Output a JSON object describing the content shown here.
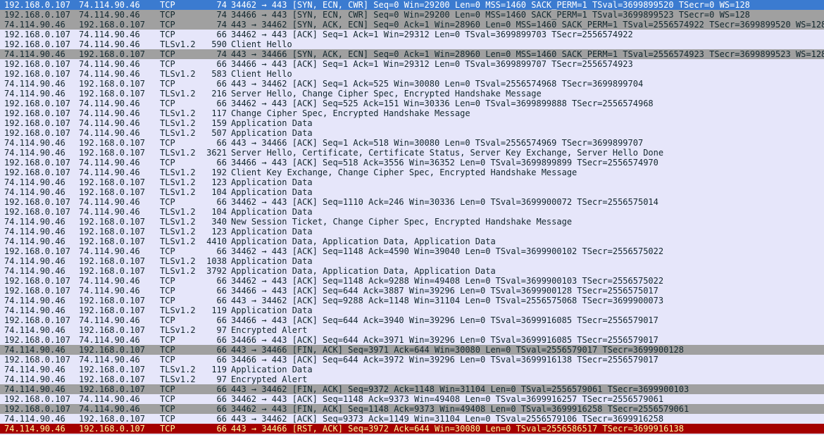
{
  "packets": [
    {
      "src": "192.168.0.107",
      "dst": "74.114.90.46",
      "proto": "TCP",
      "len": "74",
      "info": "34462 → 443 [SYN, ECN, CWR] Seq=0 Win=29200 Len=0 MSS=1460 SACK_PERM=1 TSval=3699899520 TSecr=0 WS=128",
      "style": "sel"
    },
    {
      "src": "192.168.0.107",
      "dst": "74.114.90.46",
      "proto": "TCP",
      "len": "74",
      "info": "34466 → 443 [SYN, ECN, CWR] Seq=0 Win=29200 Len=0 MSS=1460 SACK_PERM=1 TSval=3699899523 TSecr=0 WS=128",
      "style": "flag"
    },
    {
      "src": "74.114.90.46",
      "dst": "192.168.0.107",
      "proto": "TCP",
      "len": "74",
      "info": "443 → 34462 [SYN, ACK, ECN] Seq=0 Ack=1 Win=28960 Len=0 MSS=1460 SACK_PERM=1 TSval=2556574922 TSecr=3699899520 WS=128",
      "style": "flag"
    },
    {
      "src": "192.168.0.107",
      "dst": "74.114.90.46",
      "proto": "TCP",
      "len": "66",
      "info": "34462 → 443 [ACK] Seq=1 Ack=1 Win=29312 Len=0 TSval=3699899703 TSecr=2556574922",
      "style": ""
    },
    {
      "src": "192.168.0.107",
      "dst": "74.114.90.46",
      "proto": "TLSv1.2",
      "len": "590",
      "info": "Client Hello",
      "style": ""
    },
    {
      "src": "74.114.90.46",
      "dst": "192.168.0.107",
      "proto": "TCP",
      "len": "74",
      "info": "443 → 34466 [SYN, ACK, ECN] Seq=0 Ack=1 Win=28960 Len=0 MSS=1460 SACK_PERM=1 TSval=2556574923 TSecr=3699899523 WS=128",
      "style": "flag"
    },
    {
      "src": "192.168.0.107",
      "dst": "74.114.90.46",
      "proto": "TCP",
      "len": "66",
      "info": "34466 → 443 [ACK] Seq=1 Ack=1 Win=29312 Len=0 TSval=3699899707 TSecr=2556574923",
      "style": ""
    },
    {
      "src": "192.168.0.107",
      "dst": "74.114.90.46",
      "proto": "TLSv1.2",
      "len": "583",
      "info": "Client Hello",
      "style": ""
    },
    {
      "src": "74.114.90.46",
      "dst": "192.168.0.107",
      "proto": "TCP",
      "len": "66",
      "info": "443 → 34462 [ACK] Seq=1 Ack=525 Win=30080 Len=0 TSval=2556574968 TSecr=3699899704",
      "style": ""
    },
    {
      "src": "74.114.90.46",
      "dst": "192.168.0.107",
      "proto": "TLSv1.2",
      "len": "216",
      "info": "Server Hello, Change Cipher Spec, Encrypted Handshake Message",
      "style": ""
    },
    {
      "src": "192.168.0.107",
      "dst": "74.114.90.46",
      "proto": "TCP",
      "len": "66",
      "info": "34462 → 443 [ACK] Seq=525 Ack=151 Win=30336 Len=0 TSval=3699899888 TSecr=2556574968",
      "style": ""
    },
    {
      "src": "192.168.0.107",
      "dst": "74.114.90.46",
      "proto": "TLSv1.2",
      "len": "117",
      "info": "Change Cipher Spec, Encrypted Handshake Message",
      "style": ""
    },
    {
      "src": "192.168.0.107",
      "dst": "74.114.90.46",
      "proto": "TLSv1.2",
      "len": "159",
      "info": "Application Data",
      "style": ""
    },
    {
      "src": "192.168.0.107",
      "dst": "74.114.90.46",
      "proto": "TLSv1.2",
      "len": "507",
      "info": "Application Data",
      "style": ""
    },
    {
      "src": "74.114.90.46",
      "dst": "192.168.0.107",
      "proto": "TCP",
      "len": "66",
      "info": "443 → 34466 [ACK] Seq=1 Ack=518 Win=30080 Len=0 TSval=2556574969 TSecr=3699899707",
      "style": ""
    },
    {
      "src": "74.114.90.46",
      "dst": "192.168.0.107",
      "proto": "TLSv1.2",
      "len": "3621",
      "info": "Server Hello, Certificate, Certificate Status, Server Key Exchange, Server Hello Done",
      "style": ""
    },
    {
      "src": "192.168.0.107",
      "dst": "74.114.90.46",
      "proto": "TCP",
      "len": "66",
      "info": "34466 → 443 [ACK] Seq=518 Ack=3556 Win=36352 Len=0 TSval=3699899899 TSecr=2556574970",
      "style": ""
    },
    {
      "src": "192.168.0.107",
      "dst": "74.114.90.46",
      "proto": "TLSv1.2",
      "len": "192",
      "info": "Client Key Exchange, Change Cipher Spec, Encrypted Handshake Message",
      "style": ""
    },
    {
      "src": "74.114.90.46",
      "dst": "192.168.0.107",
      "proto": "TLSv1.2",
      "len": "123",
      "info": "Application Data",
      "style": ""
    },
    {
      "src": "74.114.90.46",
      "dst": "192.168.0.107",
      "proto": "TLSv1.2",
      "len": "104",
      "info": "Application Data",
      "style": ""
    },
    {
      "src": "192.168.0.107",
      "dst": "74.114.90.46",
      "proto": "TCP",
      "len": "66",
      "info": "34462 → 443 [ACK] Seq=1110 Ack=246 Win=30336 Len=0 TSval=3699900072 TSecr=2556575014",
      "style": ""
    },
    {
      "src": "192.168.0.107",
      "dst": "74.114.90.46",
      "proto": "TLSv1.2",
      "len": "104",
      "info": "Application Data",
      "style": ""
    },
    {
      "src": "74.114.90.46",
      "dst": "192.168.0.107",
      "proto": "TLSv1.2",
      "len": "340",
      "info": "New Session Ticket, Change Cipher Spec, Encrypted Handshake Message",
      "style": ""
    },
    {
      "src": "74.114.90.46",
      "dst": "192.168.0.107",
      "proto": "TLSv1.2",
      "len": "123",
      "info": "Application Data",
      "style": ""
    },
    {
      "src": "74.114.90.46",
      "dst": "192.168.0.107",
      "proto": "TLSv1.2",
      "len": "4410",
      "info": "Application Data, Application Data, Application Data",
      "style": ""
    },
    {
      "src": "192.168.0.107",
      "dst": "74.114.90.46",
      "proto": "TCP",
      "len": "66",
      "info": "34462 → 443 [ACK] Seq=1148 Ack=4590 Win=39040 Len=0 TSval=3699900102 TSecr=2556575022",
      "style": ""
    },
    {
      "src": "74.114.90.46",
      "dst": "192.168.0.107",
      "proto": "TLSv1.2",
      "len": "1038",
      "info": "Application Data",
      "style": ""
    },
    {
      "src": "74.114.90.46",
      "dst": "192.168.0.107",
      "proto": "TLSv1.2",
      "len": "3792",
      "info": "Application Data, Application Data, Application Data",
      "style": ""
    },
    {
      "src": "192.168.0.107",
      "dst": "74.114.90.46",
      "proto": "TCP",
      "len": "66",
      "info": "34462 → 443 [ACK] Seq=1148 Ack=9288 Win=49408 Len=0 TSval=3699900103 TSecr=2556575022",
      "style": ""
    },
    {
      "src": "192.168.0.107",
      "dst": "74.114.90.46",
      "proto": "TCP",
      "len": "66",
      "info": "34466 → 443 [ACK] Seq=644 Ack=3887 Win=39296 Len=0 TSval=3699900128 TSecr=2556575017",
      "style": ""
    },
    {
      "src": "74.114.90.46",
      "dst": "192.168.0.107",
      "proto": "TCP",
      "len": "66",
      "info": "443 → 34462 [ACK] Seq=9288 Ack=1148 Win=31104 Len=0 TSval=2556575068 TSecr=3699900073",
      "style": ""
    },
    {
      "src": "74.114.90.46",
      "dst": "192.168.0.107",
      "proto": "TLSv1.2",
      "len": "119",
      "info": "Application Data",
      "style": ""
    },
    {
      "src": "192.168.0.107",
      "dst": "74.114.90.46",
      "proto": "TCP",
      "len": "66",
      "info": "34466 → 443 [ACK] Seq=644 Ack=3940 Win=39296 Len=0 TSval=3699916085 TSecr=2556579017",
      "style": ""
    },
    {
      "src": "74.114.90.46",
      "dst": "192.168.0.107",
      "proto": "TLSv1.2",
      "len": "97",
      "info": "Encrypted Alert",
      "style": ""
    },
    {
      "src": "192.168.0.107",
      "dst": "74.114.90.46",
      "proto": "TCP",
      "len": "66",
      "info": "34466 → 443 [ACK] Seq=644 Ack=3971 Win=39296 Len=0 TSval=3699916085 TSecr=2556579017",
      "style": ""
    },
    {
      "src": "74.114.90.46",
      "dst": "192.168.0.107",
      "proto": "TCP",
      "len": "66",
      "info": "443 → 34466 [FIN, ACK] Seq=3971 Ack=644 Win=30080 Len=0 TSval=2556579017 TSecr=3699900128",
      "style": "flag"
    },
    {
      "src": "192.168.0.107",
      "dst": "74.114.90.46",
      "proto": "TCP",
      "len": "66",
      "info": "34466 → 443 [ACK] Seq=644 Ack=3972 Win=39296 Len=0 TSval=3699916138 TSecr=2556579017",
      "style": ""
    },
    {
      "src": "74.114.90.46",
      "dst": "192.168.0.107",
      "proto": "TLSv1.2",
      "len": "119",
      "info": "Application Data",
      "style": ""
    },
    {
      "src": "74.114.90.46",
      "dst": "192.168.0.107",
      "proto": "TLSv1.2",
      "len": "97",
      "info": "Encrypted Alert",
      "style": ""
    },
    {
      "src": "74.114.90.46",
      "dst": "192.168.0.107",
      "proto": "TCP",
      "len": "66",
      "info": "443 → 34462 [FIN, ACK] Seq=9372 Ack=1148 Win=31104 Len=0 TSval=2556579061 TSecr=3699900103",
      "style": "flag"
    },
    {
      "src": "192.168.0.107",
      "dst": "74.114.90.46",
      "proto": "TCP",
      "len": "66",
      "info": "34462 → 443 [ACK] Seq=1148 Ack=9373 Win=49408 Len=0 TSval=3699916257 TSecr=2556579061",
      "style": ""
    },
    {
      "src": "192.168.0.107",
      "dst": "74.114.90.46",
      "proto": "TCP",
      "len": "66",
      "info": "34462 → 443 [FIN, ACK] Seq=1148 Ack=9373 Win=49408 Len=0 TSval=3699916258 TSecr=2556579061",
      "style": "flag"
    },
    {
      "src": "74.114.90.46",
      "dst": "192.168.0.107",
      "proto": "TCP",
      "len": "66",
      "info": "443 → 34462 [ACK] Seq=9373 Ack=1149 Win=31104 Len=0 TSval=2556579106 TSecr=3699916258",
      "style": ""
    },
    {
      "src": "74.114.90.46",
      "dst": "192.168.0.107",
      "proto": "TCP",
      "len": "66",
      "info": "443 → 34466 [RST, ACK] Seq=3972 Ack=644 Win=30080 Len=0 TSval=2556586517 TSecr=3699916138",
      "style": "rst"
    }
  ]
}
